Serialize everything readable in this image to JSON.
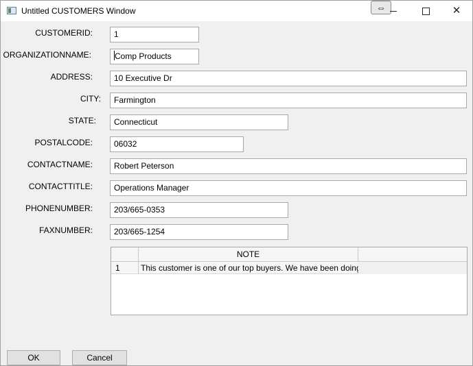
{
  "window": {
    "title": "Untitled CUSTOMERS Window",
    "icon": "app-window-icon",
    "resize_glyph": "⇔"
  },
  "form": {
    "fields": [
      {
        "label": "CUSTOMERID:",
        "value": "1"
      },
      {
        "label": "ORGANIZATIONNAME:",
        "value": "Comp Products"
      },
      {
        "label": "ADDRESS:",
        "value": "10 Executive Dr"
      },
      {
        "label": "CITY:",
        "value": "Farmington"
      },
      {
        "label": "STATE:",
        "value": "Connecticut"
      },
      {
        "label": "POSTALCODE:",
        "value": "06032"
      },
      {
        "label": "CONTACTNAME:",
        "value": "Robert Peterson"
      },
      {
        "label": "CONTACTTITLE:",
        "value": "Operations Manager"
      },
      {
        "label": "PHONENUMBER:",
        "value": "203/665-0353"
      },
      {
        "label": "FAXNUMBER:",
        "value": "203/665-1254"
      }
    ]
  },
  "notes_grid": {
    "column_header": "NOTE",
    "rows": [
      {
        "num": "1",
        "note": "This customer is one of our top buyers.  We have been doing"
      }
    ]
  },
  "buttons": {
    "ok": "OK",
    "cancel": "Cancel"
  }
}
